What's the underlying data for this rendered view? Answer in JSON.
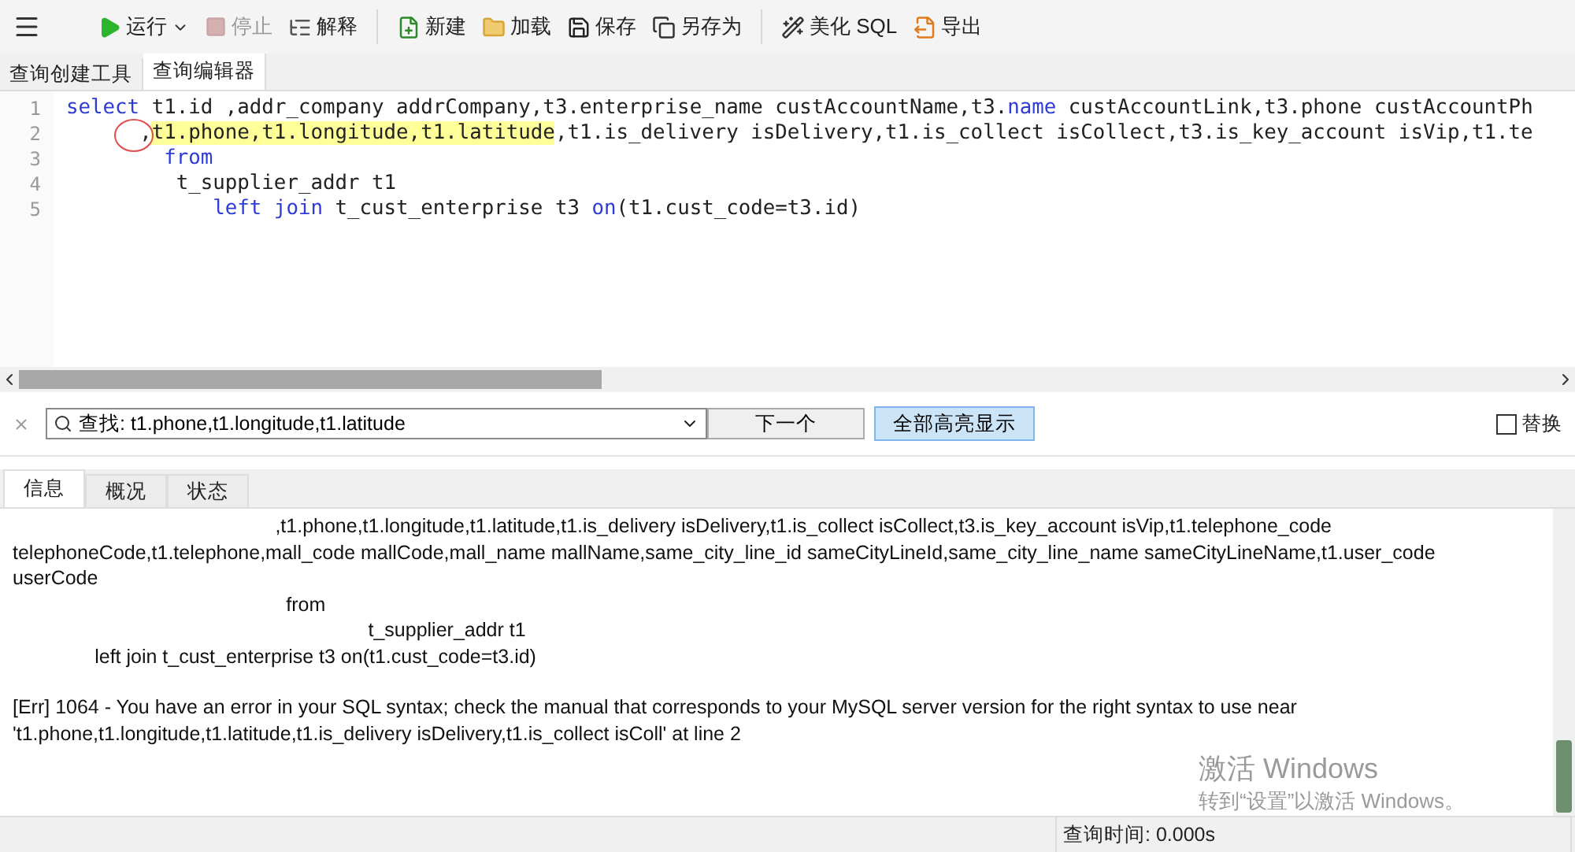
{
  "toolbar": {
    "buttons": [
      {
        "label": "运行",
        "disabled": false,
        "dropdown": true
      },
      {
        "label": "停止",
        "disabled": true,
        "dropdown": false
      },
      {
        "label": "解释",
        "disabled": false,
        "dropdown": false
      },
      {
        "label": "新建",
        "disabled": false,
        "dropdown": false
      },
      {
        "label": "加载",
        "disabled": false,
        "dropdown": false
      },
      {
        "label": "保存",
        "disabled": false,
        "dropdown": false
      },
      {
        "label": "另存为",
        "disabled": false,
        "dropdown": false
      },
      {
        "label": "美化 SQL",
        "disabled": false,
        "dropdown": false
      },
      {
        "label": "导出",
        "disabled": false,
        "dropdown": false
      }
    ]
  },
  "tabs": [
    {
      "label": "查询创建工具",
      "selected": false
    },
    {
      "label": "查询编辑器",
      "selected": true
    }
  ],
  "editor": {
    "lines": [
      {
        "number": "1",
        "segments": [
          {
            "kind": "kw",
            "text": "select"
          },
          {
            "kind": "plain",
            "text": " t1.id ,addr_company addrCompany,t3.enterprise_name custAccountName,t3."
          },
          {
            "kind": "kw",
            "text": "name"
          },
          {
            "kind": "plain",
            "text": " custAccountLink,t3.phone custAccountPh"
          }
        ]
      },
      {
        "number": "2",
        "segments": [
          {
            "kind": "plain",
            "text": "      ,"
          },
          {
            "kind": "hl",
            "text": "t1.phone,t1.longitude,t1.latitude"
          },
          {
            "kind": "plain",
            "text": ",t1.is_delivery isDelivery,t1.is_collect isCollect,t3.is_key_account isVip,t1.te"
          }
        ]
      },
      {
        "number": "3",
        "segments": [
          {
            "kind": "kw",
            "text": "        from"
          }
        ]
      },
      {
        "number": "4",
        "segments": [
          {
            "kind": "plain",
            "text": "         t_supplier_addr t1"
          }
        ]
      },
      {
        "number": "5",
        "segments": [
          {
            "kind": "kw",
            "text": "            left join"
          },
          {
            "kind": "plain",
            "text": " t_cust_enterprise t3 "
          },
          {
            "kind": "kw",
            "text": "on"
          },
          {
            "kind": "plain",
            "text": "(t1.cust_code=t3.id)"
          }
        ]
      }
    ]
  },
  "find_bar": {
    "value": "查找: t1.phone,t1.longitude,t1.latitude",
    "next_button": "下一个",
    "highlight_all": {
      "label": "全部高亮显示",
      "on": true
    },
    "replace": {
      "label": "替换",
      "checked": false
    }
  },
  "result_tabs": [
    {
      "label": "信息",
      "selected": true
    },
    {
      "label": "概况",
      "selected": false
    },
    {
      "label": "状态",
      "selected": false
    }
  ],
  "message": {
    "lines": [
      "                                                ,t1.phone,t1.longitude,t1.latitude,t1.is_delivery isDelivery,t1.is_collect isCollect,t3.is_key_account isVip,t1.telephone_code telephoneCode,t1.telephone,mall_code mallCode,mall_name mallName,same_city_line_id sameCityLineId,same_city_line_name sameCityLineName,t1.user_code userCode",
      "                                                  from",
      "                                                                 t_supplier_addr t1",
      "               left join t_cust_enterprise t3 on(t1.cust_code=t3.id)"
    ],
    "error": "[Err] 1064 - You have an error in your SQL syntax; check the manual that corresponds to your MySQL server version for the right syntax to use near 't1.phone,t1.longitude,t1.latitude,t1.is_delivery isDelivery,t1.is_collect isColl' at line 2"
  },
  "os_notice": {
    "title": "激活 Windows",
    "text": "转到“设置”以激活 Windows。"
  },
  "status_bar": {
    "query_time": "查询时间: 0.000s"
  }
}
